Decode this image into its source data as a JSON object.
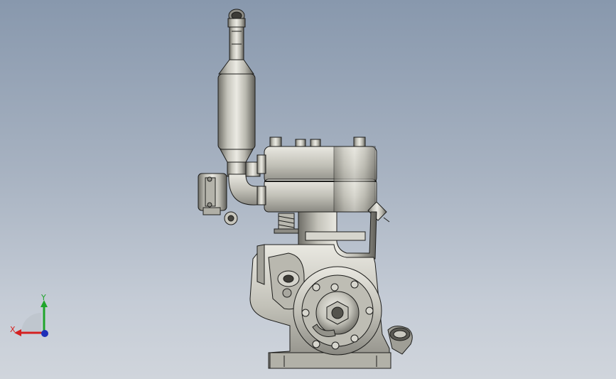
{
  "viewport": {
    "background_top": "#8898ad",
    "background_bottom": "#d0d5dc"
  },
  "model": {
    "body_color": "#c9c8bf",
    "shadow_color": "#6e6d66",
    "edge_color": "#1d1d1b"
  },
  "triad": {
    "x_label": "X",
    "y_label": "Y",
    "x_color": "#d42121",
    "y_color": "#1fa52b",
    "z_color": "#1e2fb8"
  }
}
